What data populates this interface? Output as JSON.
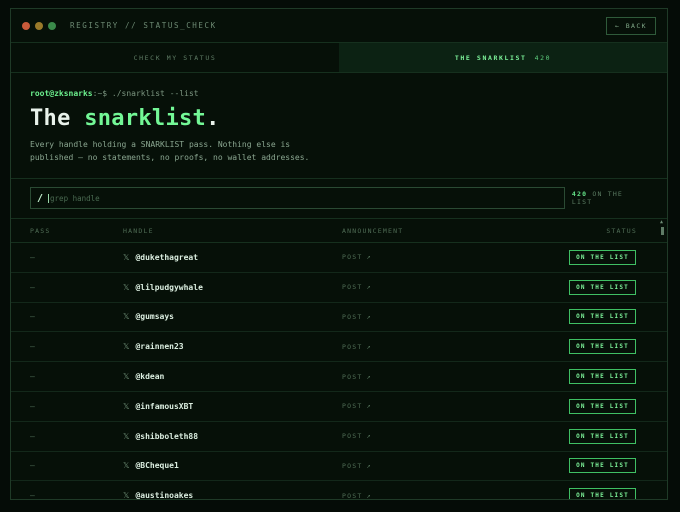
{
  "window": {
    "title": "REGISTRY // STATUS_CHECK",
    "back_label": "← BACK",
    "dot_colors": [
      "#c85a3a",
      "#9a7a2a",
      "#3a8a4a"
    ]
  },
  "tabs": [
    {
      "label": "CHECK MY STATUS",
      "active": false
    },
    {
      "label": "THE SNARKLIST",
      "count": "420",
      "active": true
    }
  ],
  "intro": {
    "prompt_user": "root@zksnarks",
    "prompt_cmd": ":~$ ./snarklist --list",
    "headline_pre": "The ",
    "headline_accent": "snarklist",
    "headline_post": ".",
    "description": "Every handle holding a SNARKLIST pass. Nothing else is published — no statements, no proofs, no wallet addresses."
  },
  "search": {
    "slash": "/",
    "placeholder": "grep handle",
    "value": "",
    "count": "420",
    "count_suffix": "ON THE LIST"
  },
  "table": {
    "columns": [
      "PASS",
      "HANDLE",
      "ANNOUNCEMENT",
      "STATUS"
    ],
    "rows": [
      {
        "pass": "—",
        "handle": "@dukethagreat",
        "announcement": "POST",
        "status": "ON THE LIST"
      },
      {
        "pass": "—",
        "handle": "@lilpudgywhale",
        "announcement": "POST",
        "status": "ON THE LIST"
      },
      {
        "pass": "—",
        "handle": "@gumsays",
        "announcement": "POST",
        "status": "ON THE LIST"
      },
      {
        "pass": "—",
        "handle": "@rainnen23",
        "announcement": "POST",
        "status": "ON THE LIST"
      },
      {
        "pass": "—",
        "handle": "@kdean",
        "announcement": "POST",
        "status": "ON THE LIST"
      },
      {
        "pass": "—",
        "handle": "@infamousXBT",
        "announcement": "POST",
        "status": "ON THE LIST"
      },
      {
        "pass": "—",
        "handle": "@shibboleth88",
        "announcement": "POST",
        "status": "ON THE LIST"
      },
      {
        "pass": "—",
        "handle": "@BCheque1",
        "announcement": "POST",
        "status": "ON THE LIST"
      },
      {
        "pass": "—",
        "handle": "@austinoakes",
        "announcement": "POST",
        "status": "ON THE LIST"
      }
    ]
  },
  "icons": {
    "x_glyph": "𝕏",
    "arrow_glyph": "↗",
    "scroll_up": "▲",
    "scroll_down": "▼"
  }
}
